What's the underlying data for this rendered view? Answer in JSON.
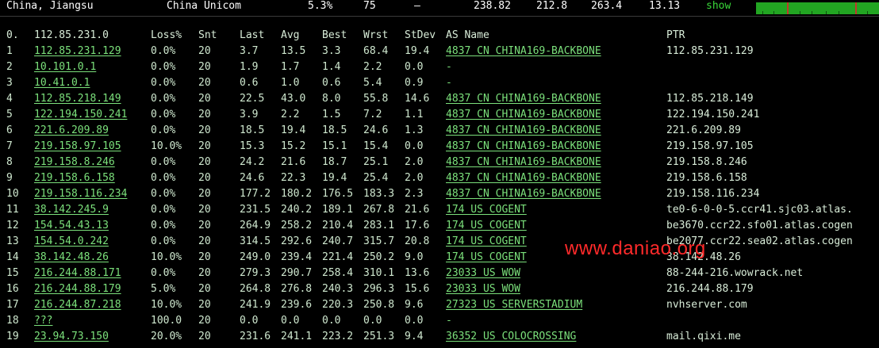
{
  "summary": {
    "location": "China, Jiangsu",
    "isp": "China Unicom",
    "loss": "5.3%",
    "snt": "75",
    "dash": "–",
    "last": "238.82",
    "avg": "212.8",
    "best": "263.4",
    "stdev": "13.13",
    "show_label": "show",
    "spark_colors": {
      "ok": "#22a522",
      "loss": "#c0392b"
    }
  },
  "table": {
    "headers": {
      "hop": "0.",
      "ip": "112.85.231.0",
      "loss": "Loss%",
      "snt": "Snt",
      "last": "Last",
      "avg": "Avg",
      "best": "Best",
      "wrst": "Wrst",
      "stdev": "StDev",
      "as": "AS Name",
      "ptr": "PTR"
    },
    "rows": [
      {
        "hop": "1",
        "ip": "112.85.231.129",
        "loss": "0.0%",
        "snt": "20",
        "last": "3.7",
        "avg": "13.5",
        "best": "3.3",
        "wrst": "68.4",
        "stdev": "19.4",
        "as": "4837  CN CHINA169-BACKBONE",
        "ptr": "112.85.231.129"
      },
      {
        "hop": "2",
        "ip": "10.101.0.1",
        "loss": "0.0%",
        "snt": "20",
        "last": "1.9",
        "avg": "1.7",
        "best": "1.4",
        "wrst": "2.2",
        "stdev": "0.0",
        "as": "-",
        "ptr": ""
      },
      {
        "hop": "3",
        "ip": "10.41.0.1",
        "loss": "0.0%",
        "snt": "20",
        "last": "0.6",
        "avg": "1.0",
        "best": "0.6",
        "wrst": "5.4",
        "stdev": "0.9",
        "as": "-",
        "ptr": ""
      },
      {
        "hop": "4",
        "ip": "112.85.218.149",
        "loss": "0.0%",
        "snt": "20",
        "last": "22.5",
        "avg": "43.0",
        "best": "8.0",
        "wrst": "55.8",
        "stdev": "14.6",
        "as": "4837  CN CHINA169-BACKBONE",
        "ptr": "112.85.218.149"
      },
      {
        "hop": "5",
        "ip": "122.194.150.241",
        "loss": "0.0%",
        "snt": "20",
        "last": "3.9",
        "avg": "2.2",
        "best": "1.5",
        "wrst": "7.2",
        "stdev": "1.1",
        "as": "4837  CN CHINA169-BACKBONE",
        "ptr": "122.194.150.241"
      },
      {
        "hop": "6",
        "ip": "221.6.209.89",
        "loss": "0.0%",
        "snt": "20",
        "last": "18.5",
        "avg": "19.4",
        "best": "18.5",
        "wrst": "24.6",
        "stdev": "1.3",
        "as": "4837  CN CHINA169-BACKBONE",
        "ptr": "221.6.209.89"
      },
      {
        "hop": "7",
        "ip": "219.158.97.105",
        "loss": "10.0%",
        "snt": "20",
        "last": "15.3",
        "avg": "15.2",
        "best": "15.1",
        "wrst": "15.4",
        "stdev": "0.0",
        "as": "4837  CN CHINA169-BACKBONE",
        "ptr": "219.158.97.105"
      },
      {
        "hop": "8",
        "ip": "219.158.8.246",
        "loss": "0.0%",
        "snt": "20",
        "last": "24.2",
        "avg": "21.6",
        "best": "18.7",
        "wrst": "25.1",
        "stdev": "2.0",
        "as": "4837  CN CHINA169-BACKBONE",
        "ptr": "219.158.8.246"
      },
      {
        "hop": "9",
        "ip": "219.158.6.158",
        "loss": "0.0%",
        "snt": "20",
        "last": "24.6",
        "avg": "22.3",
        "best": "19.4",
        "wrst": "25.4",
        "stdev": "2.0",
        "as": "4837  CN CHINA169-BACKBONE",
        "ptr": "219.158.6.158"
      },
      {
        "hop": "10",
        "ip": "219.158.116.234",
        "loss": "0.0%",
        "snt": "20",
        "last": "177.2",
        "avg": "180.2",
        "best": "176.5",
        "wrst": "183.3",
        "stdev": "2.3",
        "as": "4837  CN CHINA169-BACKBONE",
        "ptr": "219.158.116.234"
      },
      {
        "hop": "11",
        "ip": "38.142.245.9",
        "loss": "0.0%",
        "snt": "20",
        "last": "231.5",
        "avg": "240.2",
        "best": "189.1",
        "wrst": "267.8",
        "stdev": "21.6",
        "as": "174   US COGENT",
        "ptr": "te0-6-0-0-5.ccr41.sjc03.atlas."
      },
      {
        "hop": "12",
        "ip": "154.54.43.13",
        "loss": "0.0%",
        "snt": "20",
        "last": "264.9",
        "avg": "258.2",
        "best": "210.4",
        "wrst": "283.1",
        "stdev": "17.6",
        "as": "174   US COGENT",
        "ptr": "be3670.ccr22.sfo01.atlas.cogen"
      },
      {
        "hop": "13",
        "ip": "154.54.0.242",
        "loss": "0.0%",
        "snt": "20",
        "last": "314.5",
        "avg": "292.6",
        "best": "240.7",
        "wrst": "315.7",
        "stdev": "20.8",
        "as": "174   US COGENT",
        "ptr": "be2077.ccr22.sea02.atlas.cogen"
      },
      {
        "hop": "14",
        "ip": "38.142.48.26",
        "loss": "10.0%",
        "snt": "20",
        "last": "249.0",
        "avg": "239.4",
        "best": "221.4",
        "wrst": "250.2",
        "stdev": "9.0",
        "as": "174   US COGENT",
        "ptr": "38.142.48.26"
      },
      {
        "hop": "15",
        "ip": "216.244.88.171",
        "loss": "0.0%",
        "snt": "20",
        "last": "279.3",
        "avg": "290.7",
        "best": "258.4",
        "wrst": "310.1",
        "stdev": "13.6",
        "as": "23033 US WOW",
        "ptr": "88-244-216.wowrack.net"
      },
      {
        "hop": "16",
        "ip": "216.244.88.179",
        "loss": "5.0%",
        "snt": "20",
        "last": "264.8",
        "avg": "276.8",
        "best": "240.3",
        "wrst": "296.3",
        "stdev": "15.6",
        "as": "23033 US WOW",
        "ptr": "216.244.88.179"
      },
      {
        "hop": "17",
        "ip": "216.244.87.218",
        "loss": "10.0%",
        "snt": "20",
        "last": "241.9",
        "avg": "239.6",
        "best": "220.3",
        "wrst": "250.8",
        "stdev": "9.6",
        "as": "27323 US SERVERSTADIUM",
        "ptr": "nvhserver.com"
      },
      {
        "hop": "18",
        "ip": "???",
        "loss": "100.0",
        "snt": "20",
        "last": "0.0",
        "avg": "0.0",
        "best": "0.0",
        "wrst": "0.0",
        "stdev": "0.0",
        "as": "-",
        "ptr": ""
      },
      {
        "hop": "19",
        "ip": "23.94.73.150",
        "loss": "20.0%",
        "snt": "20",
        "last": "231.6",
        "avg": "241.1",
        "best": "223.2",
        "wrst": "251.3",
        "stdev": "9.4",
        "as": "36352 US COLOCROSSING",
        "ptr": "mail.qixi.me"
      }
    ]
  },
  "watermark": "www.daniao.org"
}
